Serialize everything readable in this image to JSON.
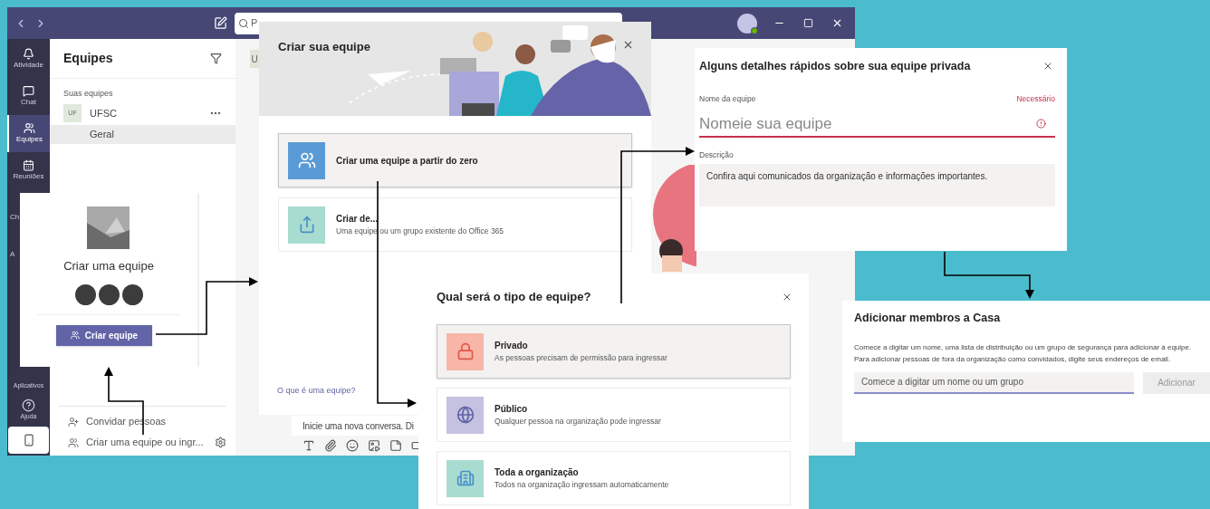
{
  "teams_window": {
    "search": {
      "placeholder": "P"
    },
    "rail": [
      {
        "label": "Atividade",
        "selected": false
      },
      {
        "label": "Chat",
        "selected": false
      },
      {
        "label": "Equipes",
        "selected": true
      },
      {
        "label": "Reuniões",
        "selected": false
      },
      {
        "label": "Ch",
        "selected": false
      },
      {
        "label": "A",
        "selected": false
      }
    ],
    "rail_bottom": [
      "Aplicativos",
      "Ajuda"
    ],
    "sidebar": {
      "title": "Equipes",
      "section": "Suas equipes",
      "teams": [
        {
          "avatar": "UF",
          "name": "UFSC",
          "channels": [
            {
              "name": "Geral",
              "selected": true
            }
          ]
        }
      ],
      "footer": [
        "Convidar pessoas",
        "Criar uma equipe ou ingr..."
      ]
    },
    "channel_tab": "U",
    "compose": {
      "placeholder": "Inicie uma nova conversa. Di"
    }
  },
  "create_card": {
    "title": "Criar uma equipe",
    "button": "Criar equipe"
  },
  "create_dialog": {
    "title": "Criar sua equipe",
    "options": [
      {
        "kind": "scratch",
        "title": "Criar uma equipe a partir do zero",
        "selected": true
      },
      {
        "kind": "existing",
        "title": "Criar de...",
        "subtitle": "Uma equipe ou um grupo existente do Office 365",
        "selected": false
      }
    ],
    "link": "O que é uma equipe?"
  },
  "details_dialog": {
    "title": "Alguns detalhes rápidos sobre sua equipe privada",
    "name_label": "Nome da equipe",
    "required": "Necessário",
    "name_placeholder": "Nomeie sua equipe",
    "description_label": "Descrição",
    "description_value": "Confira aqui comunicados da organização e informações importantes."
  },
  "type_dialog": {
    "title": "Qual será o tipo de equipe?",
    "options": [
      {
        "kind": "private",
        "title": "Privado",
        "subtitle": "As pessoas precisam de permissão para ingressar",
        "selected": true
      },
      {
        "kind": "public",
        "title": "Público",
        "subtitle": "Qualquer pessoa na organização pode ingressar",
        "selected": false
      },
      {
        "kind": "org",
        "title": "Toda a organização",
        "subtitle": "Todos na organização ingressam automaticamente",
        "selected": false
      }
    ]
  },
  "members_dialog": {
    "title": "Adicionar membros a Casa",
    "text": "Comece a digitar um nome, uma lista de distribuição ou um grupo de segurança para adicionar à equipe. Para adicionar pessoas de fora da organização como convidados, digite seus endereços de email.",
    "placeholder": "Comece a digitar um nome ou um grupo",
    "button": "Adicionar",
    "button_disabled": true
  }
}
